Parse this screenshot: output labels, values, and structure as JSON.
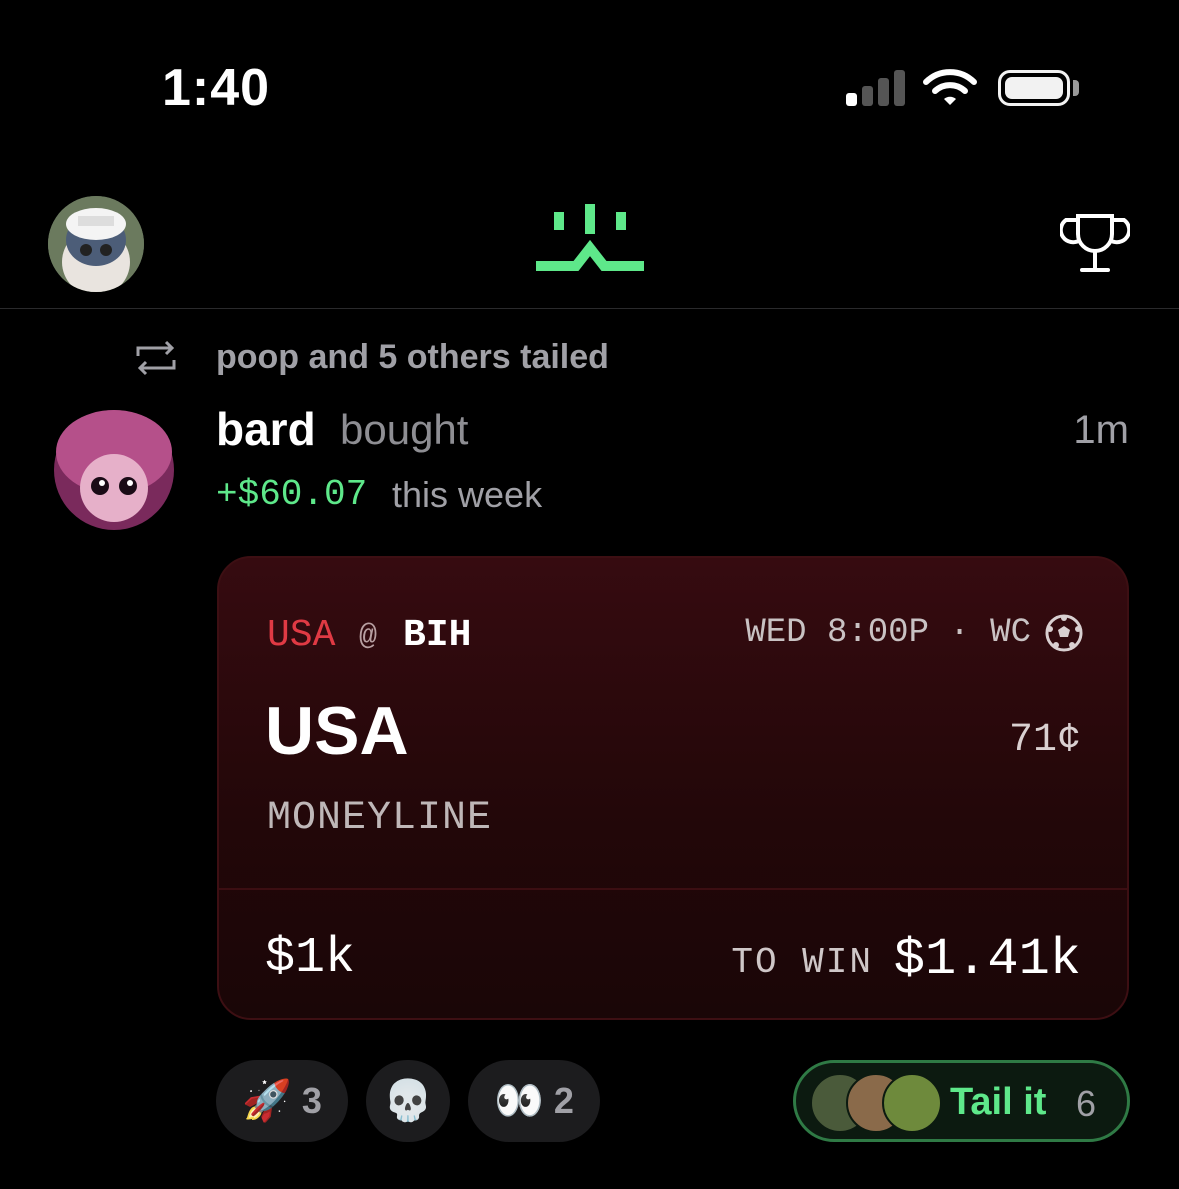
{
  "status_bar": {
    "time": "1:40",
    "battery_icon": "battery-icon",
    "wifi_icon": "wifi-icon",
    "signal_icon": "cellular-signal-icon"
  },
  "header": {
    "logo_icon": "app-logo-icon",
    "trophy_icon": "trophy-icon",
    "avatar": "profile-avatar"
  },
  "post": {
    "tailed_text": "poop and 5 others tailed",
    "user": "bard",
    "action": "bought",
    "time_ago": "1m",
    "weekly_gain": "+$60.07",
    "weekly_gain_suffix": "this week"
  },
  "bet": {
    "away_team": "USA",
    "at": "@",
    "home_team": "BIH",
    "game_time": "WED 8:00P · WC",
    "pick": "USA",
    "price": "71¢",
    "market": "MONEYLINE",
    "stake": "$1k",
    "to_win_label": "TO WIN",
    "to_win": "$1.41k"
  },
  "reactions": [
    {
      "emoji": "🚀",
      "count": "3"
    },
    {
      "emoji": "💀",
      "count": ""
    },
    {
      "emoji": "👀",
      "count": "2"
    }
  ],
  "tail_button": {
    "label": "Tail it",
    "count": "6"
  },
  "colors": {
    "accent_green": "#5ee88a",
    "away_red": "#e03a44",
    "card_bg": "#2a080b"
  }
}
